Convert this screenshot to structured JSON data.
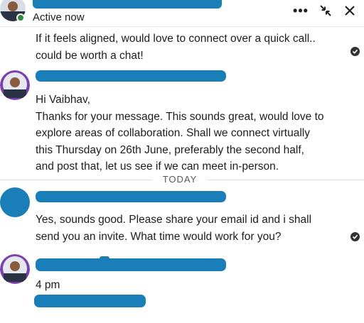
{
  "header": {
    "status": "Active now",
    "more_label": "•••"
  },
  "messages": [
    {
      "text": "If it feels aligned, would love to connect over a quick call..\ncould be worth a chat!"
    },
    {
      "text": "Hi Vaibhav,\nThanks for your message. This sounds great, would love to\nexplore areas of collaboration. Shall we connect virtually\nthis Thursday on 26th June, preferably the second half,\nand post that, let us see if we can meet in-person."
    },
    {
      "text": "Yes, sounds good. Please share your email id and i shall\nsend you an invite. What time would work for you?"
    },
    {
      "text": "4 pm"
    }
  ],
  "divider": {
    "label": "TODAY"
  },
  "colors": {
    "redaction": "#1a7fb8",
    "online": "#2e8b3a",
    "avatar_ring": "#7b3fb0"
  }
}
